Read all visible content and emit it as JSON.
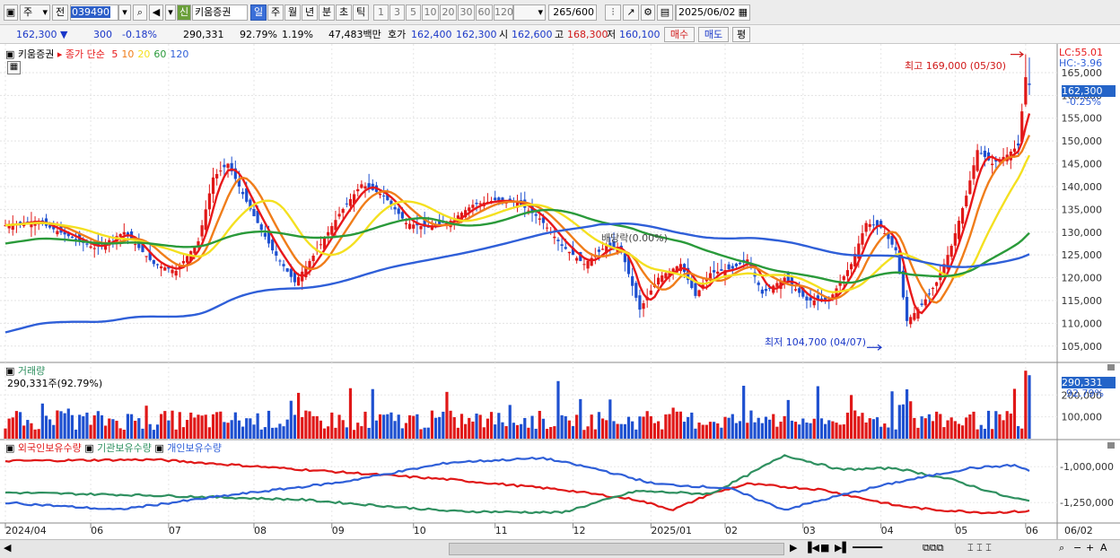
{
  "toolbar": {
    "market": "주",
    "prev_label": "전",
    "code": "039490",
    "name": "키움증권",
    "credit_badge": "신",
    "periods": [
      "일",
      "주",
      "월",
      "년",
      "분",
      "초",
      "틱"
    ],
    "active_period": "일",
    "multipliers": [
      "1",
      "3",
      "5",
      "10",
      "20",
      "30",
      "60",
      "120"
    ],
    "count": "265",
    "count_max": "/600",
    "date": "2025/06/02"
  },
  "info": {
    "price": "162,300",
    "change": "300",
    "change_pct": "-0.18%",
    "volume": "290,331",
    "vol_ratio": "92.79%",
    "turnover": "1.19%",
    "amount": "47,483백만",
    "bid_label": "호가",
    "bid": "162,400",
    "ask": "162,300",
    "open_label": "시",
    "open": "162,600",
    "high_label": "고",
    "high": "168,300",
    "low_label": "저",
    "low": "160,100",
    "buy_button": "매수",
    "sell_button": "매도",
    "eval_button": "평"
  },
  "legend": {
    "stock": "키움증권",
    "ma_title": "종가 단순",
    "ma_periods": [
      "5",
      "10",
      "20",
      "60",
      "120"
    ],
    "ma_colors": [
      "#e8181a",
      "#f07d1a",
      "#f4e020",
      "#2a9a3a",
      "#2f5fd8"
    ],
    "lc": "LC:55.01",
    "hc": "HC:-3.96",
    "current_price": "162,300",
    "current_change": "-0.25%",
    "high_note": "최고 169,000 (05/30)",
    "low_note": "최저 104,700 (04/07)",
    "dividend_note": "배당락(0.00%)"
  },
  "volume_panel": {
    "title": "거래량",
    "summary": "290,331주(92.79%)",
    "current": "290,331",
    "current_pct": "92.79%",
    "axis_labels": [
      "200,000",
      "100,000"
    ]
  },
  "holder_panel": {
    "series_titles": [
      "외국인보유수량",
      "기관보유수량",
      "개인보유수량"
    ],
    "series_colors": [
      "#e01818",
      "#2f9060",
      "#2f5fd8"
    ],
    "axis_labels": [
      "-1,000,000",
      "-1,250,000"
    ]
  },
  "x_axis": {
    "labels": [
      "2024/04",
      "06",
      "07",
      "08",
      "09",
      "10",
      "11",
      "12",
      "2025/01",
      "02",
      "03",
      "04",
      "05",
      "06"
    ],
    "right_label": "06/02"
  },
  "chart_data": {
    "type": "candlestick",
    "title": "키움증권",
    "price_axis": [
      105000,
      110000,
      115000,
      120000,
      125000,
      130000,
      135000,
      140000,
      145000,
      150000,
      155000,
      160000,
      165000
    ],
    "ylim": [
      102000,
      170500
    ],
    "x_tick_labels": [
      "2024/04",
      "06",
      "07",
      "08",
      "09",
      "10",
      "11",
      "12",
      "2025/01",
      "02",
      "03",
      "04",
      "05",
      "06"
    ],
    "close_anchors": [
      {
        "i": 0,
        "v": 131500
      },
      {
        "i": 8,
        "v": 132500
      },
      {
        "i": 16,
        "v": 129500
      },
      {
        "i": 24,
        "v": 126500
      },
      {
        "i": 32,
        "v": 130000
      },
      {
        "i": 40,
        "v": 123000
      },
      {
        "i": 46,
        "v": 121500
      },
      {
        "i": 52,
        "v": 128000
      },
      {
        "i": 56,
        "v": 142000
      },
      {
        "i": 60,
        "v": 145000
      },
      {
        "i": 66,
        "v": 135000
      },
      {
        "i": 72,
        "v": 126000
      },
      {
        "i": 78,
        "v": 119000
      },
      {
        "i": 84,
        "v": 126000
      },
      {
        "i": 90,
        "v": 134000
      },
      {
        "i": 96,
        "v": 140500
      },
      {
        "i": 102,
        "v": 138000
      },
      {
        "i": 108,
        "v": 132000
      },
      {
        "i": 114,
        "v": 131000
      },
      {
        "i": 120,
        "v": 132500
      },
      {
        "i": 126,
        "v": 136000
      },
      {
        "i": 132,
        "v": 137000
      },
      {
        "i": 138,
        "v": 136500
      },
      {
        "i": 144,
        "v": 133000
      },
      {
        "i": 150,
        "v": 127000
      },
      {
        "i": 156,
        "v": 123000
      },
      {
        "i": 162,
        "v": 127000
      },
      {
        "i": 166,
        "v": 126000
      },
      {
        "i": 171,
        "v": 113000
      },
      {
        "i": 176,
        "v": 120000
      },
      {
        "i": 182,
        "v": 123000
      },
      {
        "i": 186,
        "v": 116000
      },
      {
        "i": 190,
        "v": 121000
      },
      {
        "i": 196,
        "v": 122000
      },
      {
        "i": 200,
        "v": 124000
      },
      {
        "i": 204,
        "v": 116500
      },
      {
        "i": 210,
        "v": 120000
      },
      {
        "i": 216,
        "v": 115000
      },
      {
        "i": 222,
        "v": 115000
      },
      {
        "i": 228,
        "v": 123000
      },
      {
        "i": 232,
        "v": 132000
      },
      {
        "i": 236,
        "v": 131000
      },
      {
        "i": 240,
        "v": 126000
      },
      {
        "i": 243,
        "v": 110500
      },
      {
        "i": 247,
        "v": 114000
      },
      {
        "i": 251,
        "v": 119000
      },
      {
        "i": 255,
        "v": 127000
      },
      {
        "i": 259,
        "v": 138000
      },
      {
        "i": 262,
        "v": 148000
      },
      {
        "i": 266,
        "v": 145000
      },
      {
        "i": 270,
        "v": 147000
      },
      {
        "i": 273,
        "v": 149000
      },
      {
        "i": 275,
        "v": 164000
      },
      {
        "i": 276,
        "v": 162300
      }
    ],
    "last_candle": {
      "open": 162600,
      "high": 168300,
      "low": 160100,
      "close": 162300,
      "volume": 290331
    },
    "moving_averages": [
      5,
      10,
      20,
      60,
      120
    ],
    "volume_ylim": [
      0,
      320000
    ],
    "holder_ylim": [
      -1380000,
      -880000
    ],
    "holder_series": {
      "foreign": [
        {
          "i": 0,
          "v": -960000
        },
        {
          "i": 40,
          "v": -950000
        },
        {
          "i": 80,
          "v": -1020000
        },
        {
          "i": 120,
          "v": -1090000
        },
        {
          "i": 150,
          "v": -1160000
        },
        {
          "i": 170,
          "v": -1230000
        },
        {
          "i": 180,
          "v": -1300000
        },
        {
          "i": 190,
          "v": -1190000
        },
        {
          "i": 200,
          "v": -1120000
        },
        {
          "i": 220,
          "v": -1160000
        },
        {
          "i": 240,
          "v": -1270000
        },
        {
          "i": 250,
          "v": -1300000
        },
        {
          "i": 265,
          "v": -1320000
        },
        {
          "i": 276,
          "v": -1310000
        }
      ],
      "institution": [
        {
          "i": 0,
          "v": -1180000
        },
        {
          "i": 40,
          "v": -1200000
        },
        {
          "i": 80,
          "v": -1230000
        },
        {
          "i": 120,
          "v": -1310000
        },
        {
          "i": 150,
          "v": -1320000
        },
        {
          "i": 170,
          "v": -1170000
        },
        {
          "i": 190,
          "v": -1190000
        },
        {
          "i": 200,
          "v": -1060000
        },
        {
          "i": 210,
          "v": -920000
        },
        {
          "i": 225,
          "v": -1020000
        },
        {
          "i": 240,
          "v": -1010000
        },
        {
          "i": 255,
          "v": -1090000
        },
        {
          "i": 270,
          "v": -1210000
        },
        {
          "i": 276,
          "v": -1240000
        }
      ],
      "individual": [
        {
          "i": 0,
          "v": -1250000
        },
        {
          "i": 30,
          "v": -1300000
        },
        {
          "i": 60,
          "v": -1200000
        },
        {
          "i": 90,
          "v": -1110000
        },
        {
          "i": 120,
          "v": -970000
        },
        {
          "i": 145,
          "v": -940000
        },
        {
          "i": 160,
          "v": -1020000
        },
        {
          "i": 175,
          "v": -1120000
        },
        {
          "i": 195,
          "v": -1150000
        },
        {
          "i": 210,
          "v": -1300000
        },
        {
          "i": 225,
          "v": -1200000
        },
        {
          "i": 240,
          "v": -1110000
        },
        {
          "i": 260,
          "v": -1010000
        },
        {
          "i": 272,
          "v": -990000
        },
        {
          "i": 276,
          "v": -1030000
        }
      ]
    }
  }
}
